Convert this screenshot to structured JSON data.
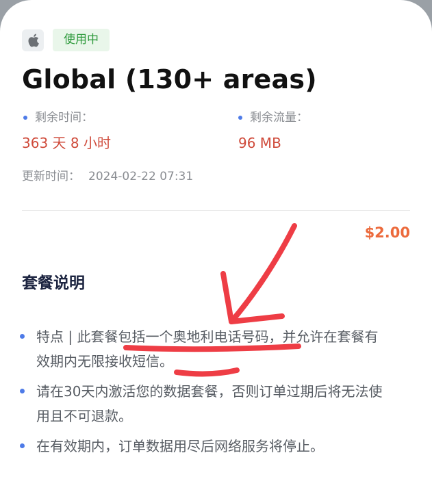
{
  "plan": {
    "status": "使用中",
    "title": "Global (130+ areas)",
    "remaining_time_label": "剩余时间：",
    "remaining_time_value": "363 天 8 小时",
    "remaining_data_label": "剩余流量：",
    "remaining_data_value": "96 MB",
    "update_label": "更新时间：",
    "update_value": "2024-02-22 07:31",
    "price": "$2.00"
  },
  "description": {
    "title": "套餐说明",
    "items": [
      "特点 | 此套餐包括一个奥地利电话号码，并允许在套餐有效期内无限接收短信。",
      "请在30天内激活您的数据套餐，否则订单过期后将无法使用且不可退款。",
      "在有效期内，订单数据用尽后网络服务将停止。"
    ]
  },
  "icons": {
    "brand": "apple-icon",
    "annotation": "red-arrow-annotation"
  },
  "colors": {
    "status_text": "#2e9a3c",
    "status_bg": "#e9f6ea",
    "remaining_value": "#cf4a3a",
    "price": "#ec6a3c",
    "bullet": "#4e7be8",
    "annotation": "#ee3d45"
  }
}
